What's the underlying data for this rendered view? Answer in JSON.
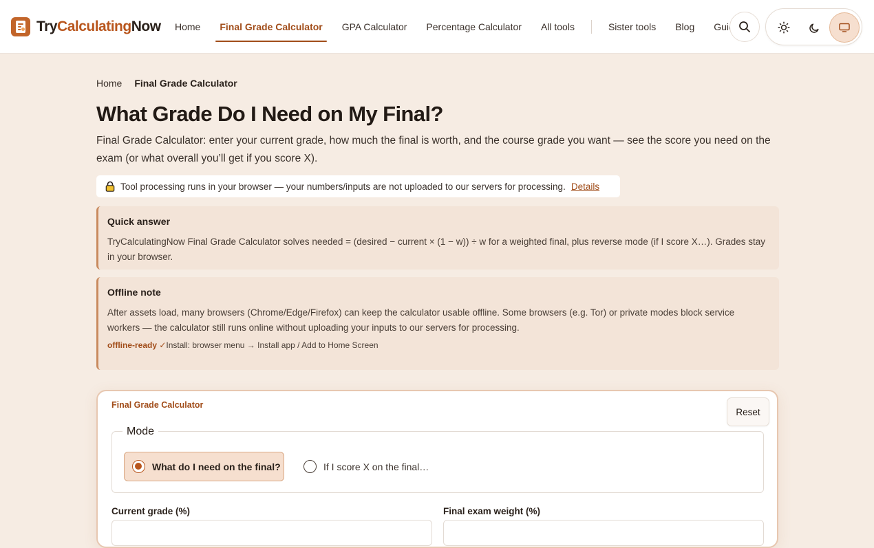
{
  "header": {
    "logo": {
      "part1": "Try",
      "part2": "Calculating",
      "part3": "Now"
    },
    "nav": [
      {
        "label": "Home"
      },
      {
        "label": "Final Grade Calculator",
        "active": true
      },
      {
        "label": "GPA Calculator"
      },
      {
        "label": "Percentage Calculator"
      },
      {
        "label": "All tools"
      },
      {
        "label": "Sister tools"
      },
      {
        "label": "Blog"
      },
      {
        "label": "Guides"
      }
    ],
    "icons": {
      "search": "search-icon",
      "light": "sun-icon",
      "dark": "moon-icon",
      "system": "monitor-icon"
    },
    "theme_active": "system"
  },
  "breadcrumb": {
    "home": "Home",
    "current": "Final Grade Calculator"
  },
  "page": {
    "title": "What Grade Do I Need on My Final?",
    "intro": "Final Grade Calculator: enter your current grade, how much the final is worth, and the course grade you want — see the score you need on the exam (or what overall you’ll get if you score X).",
    "privacy_icon": "lock-icon",
    "privacy_text": "Tool processing runs in your browser — your numbers/inputs are not uploaded to our servers for processing.",
    "privacy_link": "Details"
  },
  "quick_answer": {
    "title": "Quick answer",
    "body": "TryCalculatingNow Final Grade Calculator solves needed = (desired − current × (1 − w)) ÷ w for a weighted final, plus reverse mode (if I score X…). Grades stay in your browser."
  },
  "offline_note": {
    "title": "Offline note",
    "body": "After assets load, many browsers (Chrome/Edge/Firefox) can keep the calculator usable offline. Some browsers (e.g. Tor) or private modes block service workers — the calculator still runs online without uploading your inputs to our servers for processing.",
    "status": "offline-ready ✓",
    "install": "Install: browser menu → Install app / Add to Home Screen"
  },
  "calculator": {
    "label": "Final Grade Calculator",
    "reset": "Reset",
    "mode_legend": "Mode",
    "modes": [
      {
        "label": "What do I need on the final?",
        "selected": true
      },
      {
        "label": "If I score X on the final…",
        "selected": false
      }
    ],
    "fields": {
      "current_grade_label": "Current grade (%)",
      "final_weight_label": "Final exam weight (%)"
    }
  },
  "colors": {
    "accent": "#b9561d",
    "accent_dark": "#a14d1a",
    "page_bg": "#f6ece3",
    "note_bg": "#f3e4d8"
  }
}
